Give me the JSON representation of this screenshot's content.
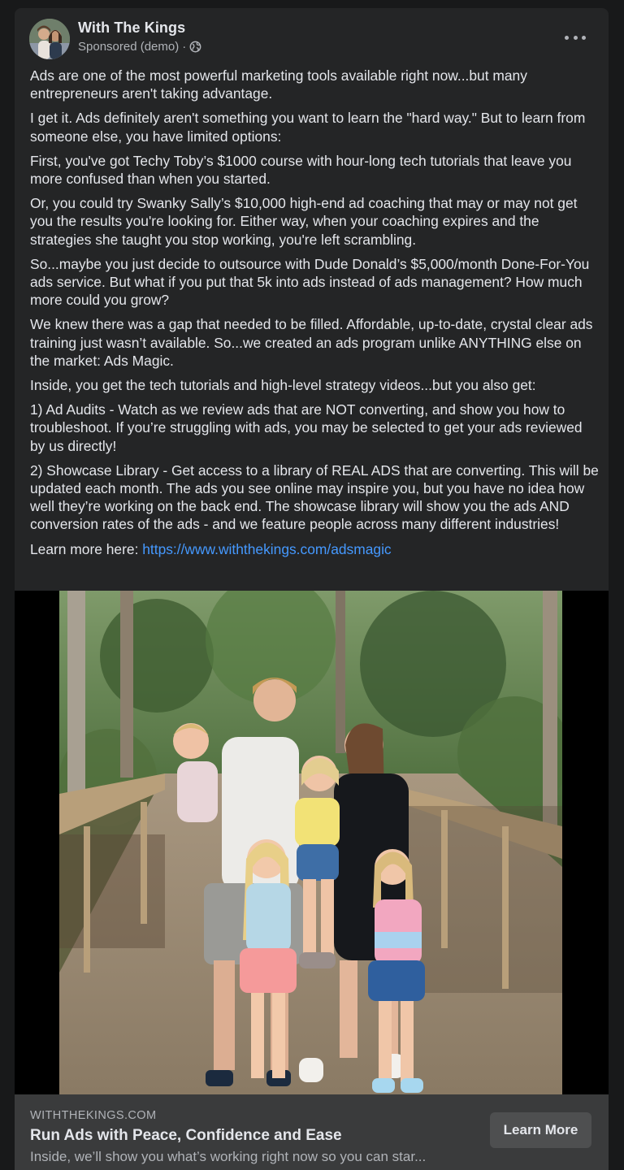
{
  "post": {
    "page_name": "With The Kings",
    "sponsored_label": "Sponsored (demo)",
    "separator": "·",
    "privacy_icon": "globe-icon",
    "more_icon": "more-horizontal-icon"
  },
  "body": {
    "paragraphs": [
      "Ads are one of the most powerful marketing tools available right now...but many entrepreneurs aren't taking advantage.",
      "I get it. Ads definitely aren't something you want to learn the \"hard way.\" But to learn from someone else, you have limited options:",
      "First, you've got Techy Toby’s $1000 course with hour-long tech tutorials that leave you more confused than when you started.",
      "Or, you could try Swanky Sally’s $10,000 high-end ad coaching that may or may not get you the results you're looking for. Either way, when your coaching expires and the strategies she taught you stop working, you're left scrambling.",
      "So...maybe you just decide to outsource with Dude Donald’s $5,000/month Done-For-You ads service. But what if you put that 5k into ads instead of ads management? How much more could you grow?",
      "We knew there was a gap that needed to be filled. Affordable, up-to-date, crystal clear ads training just wasn’t available. So...we created an ads program unlike ANYTHING else on the market: Ads Magic.",
      "Inside, you get the tech tutorials and high-level strategy videos...but you also get:",
      "1) Ad Audits - Watch as we review ads that are NOT converting, and show you how to troubleshoot. If you’re struggling with ads, you may be selected to get your ads reviewed by us directly!",
      "2) Showcase Library - Get access to a library of REAL ADS that are converting. This will be updated each month. The ads you see online may inspire you, but you have no idea how well they’re working on the back end. The showcase library will show you the ads AND conversion rates of the ads - and we feature people across many different industries!"
    ],
    "learn_more_prefix": "Learn more here: ",
    "learn_more_link": "https://www.withthekings.com/adsmagic"
  },
  "link_preview": {
    "domain": "WITHTHEKINGS.COM",
    "headline": "Run Ads with Peace, Confidence and Ease",
    "description": "Inside, we’ll show you what’s working right now so you can star...",
    "cta_label": "Learn More"
  }
}
